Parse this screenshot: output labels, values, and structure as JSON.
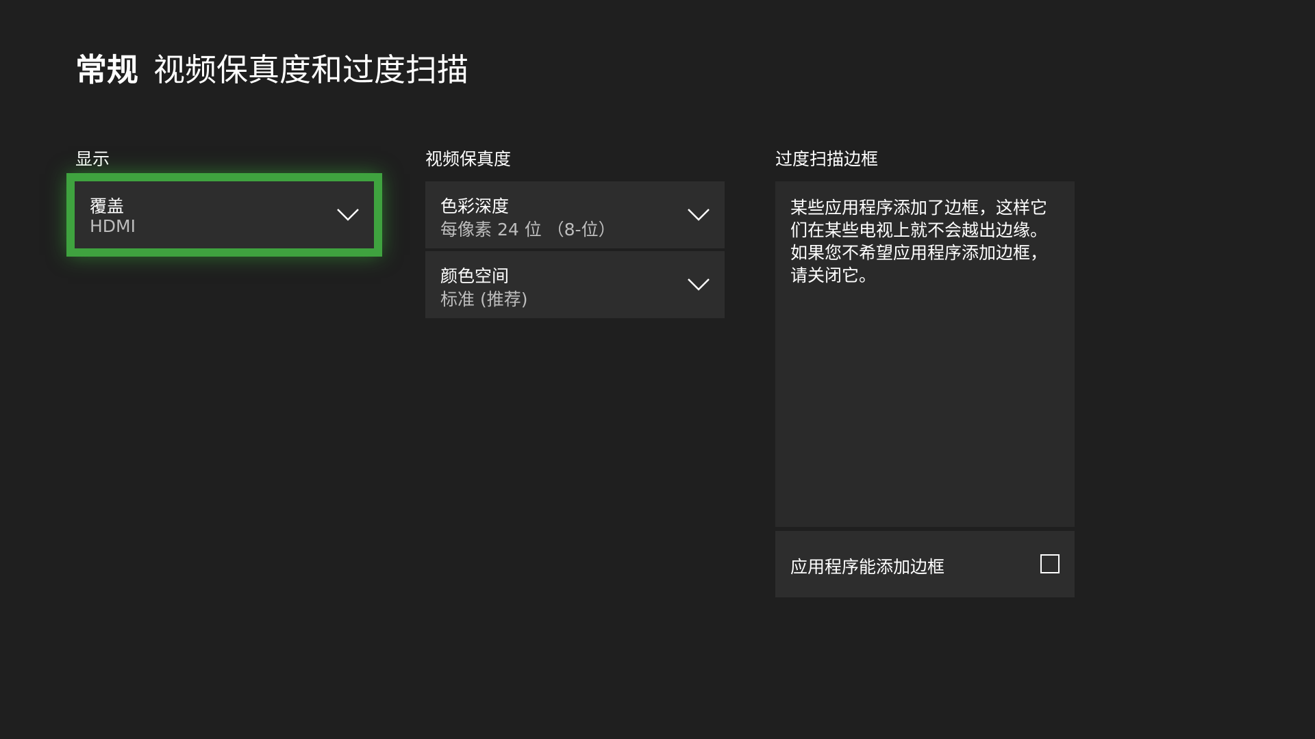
{
  "header": {
    "section": "常规",
    "title": "视频保真度和过度扫描"
  },
  "columns": {
    "display": {
      "label": "显示",
      "tile": {
        "label": "覆盖",
        "value": "HDMI",
        "icon": "chevron-down-icon"
      }
    },
    "video_fidelity": {
      "label": "视频保真度",
      "tiles": [
        {
          "label": "色彩深度",
          "value": "每像素 24 位 （8-位）",
          "icon": "chevron-down-icon"
        },
        {
          "label": "颜色空间",
          "value": "标准 (推荐)",
          "icon": "chevron-down-icon"
        }
      ]
    },
    "overscan": {
      "label": "过度扫描边框",
      "description": "某些应用程序添加了边框，这样它们在某些电视上就不会越出边缘。如果您不希望应用程序添加边框，请关闭它。",
      "checkbox": {
        "label": "应用程序能添加边框",
        "checked": false
      }
    }
  },
  "colors": {
    "background": "#1f1f1f",
    "tile": "#2d2d2d",
    "focus_accent": "#3fa33f",
    "secondary_text": "#bdbdbd"
  }
}
